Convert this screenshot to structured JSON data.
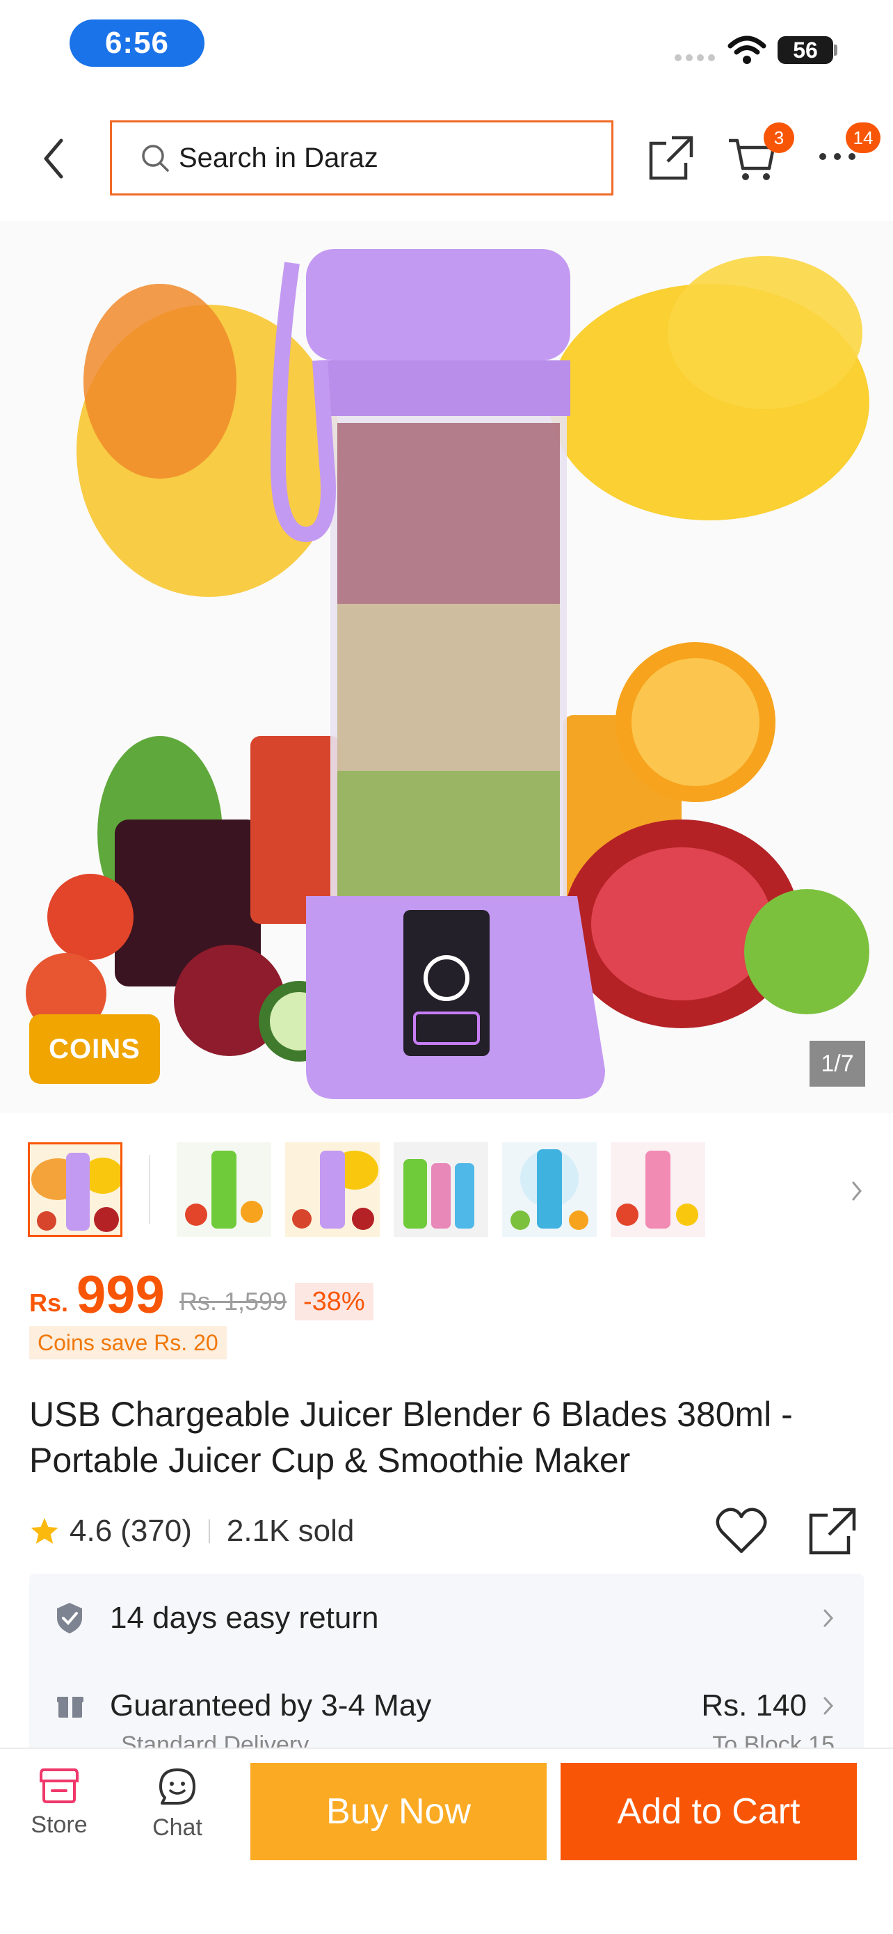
{
  "status_bar": {
    "time": "6:56",
    "battery": "56"
  },
  "header": {
    "search_placeholder": "Search in Daraz",
    "cart_count": "3",
    "more_count": "14"
  },
  "gallery": {
    "coins_badge": "COINS",
    "page_indicator": "1/7"
  },
  "price": {
    "currency": "Rs.",
    "current": "999",
    "original": "Rs. 1,599",
    "discount": "-38%",
    "coins_save": "Coins save Rs. 20"
  },
  "product": {
    "title": "USB Chargeable Juicer Blender 6 Blades 380ml - Portable Juicer Cup & Smoothie Maker",
    "rating": "4.6",
    "reviews": "(370)",
    "sold": "2.1K sold"
  },
  "services": {
    "return_text": "14 days easy return",
    "delivery_text": "Guaranteed by 3-4 May",
    "delivery_price": "Rs. 140",
    "delivery_sub": "Standard Delivery",
    "delivery_dest": "To Block 15"
  },
  "bottom_bar": {
    "store_label": "Store",
    "chat_label": "Chat",
    "buy_now": "Buy Now",
    "add_to_cart": "Add to Cart"
  },
  "colors": {
    "brand": "#f85606",
    "buy_now": "#fbaa24",
    "coins": "#f0a500",
    "product_purple": "#c39af2"
  }
}
